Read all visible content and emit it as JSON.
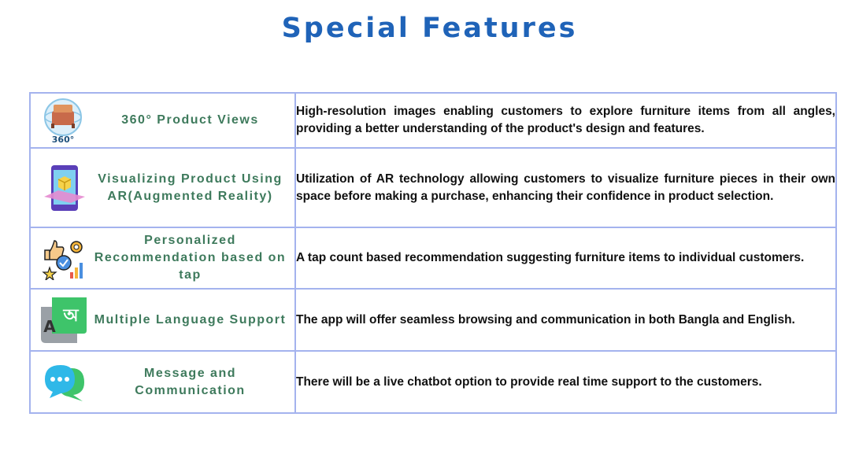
{
  "title": "Special Features",
  "features": [
    {
      "name": "360° Product Views",
      "icon": "360-product-view-icon",
      "icon_caption": "360°",
      "description": "High-resolution images enabling customers to explore furniture items from all angles, providing a better understanding of the product's design and features."
    },
    {
      "name": "Visualizing Product Using AR(Augmented Reality)",
      "icon": "ar-phone-icon",
      "description": "Utilization of AR technology allowing customers to visualize furniture pieces in their own space before making a purchase, enhancing their confidence in product selection."
    },
    {
      "name": "Personalized Recommendation based on tap",
      "icon": "recommendation-icon",
      "description": "A tap count based recommendation suggesting furniture items to individual customers."
    },
    {
      "name": "Multiple Language Support",
      "icon": "language-translate-icon",
      "icon_letters": [
        "A",
        "অ"
      ],
      "description": "The app will offer seamless browsing and communication in both Bangla and English."
    },
    {
      "name": "Message and Communication",
      "icon": "chat-bubble-icon",
      "description": "There will be a live chatbot option to provide real time support to the customers."
    }
  ],
  "colors": {
    "title": "#1f63b8",
    "feature_label": "#3e7a5c",
    "border": "#a4b3ee"
  }
}
